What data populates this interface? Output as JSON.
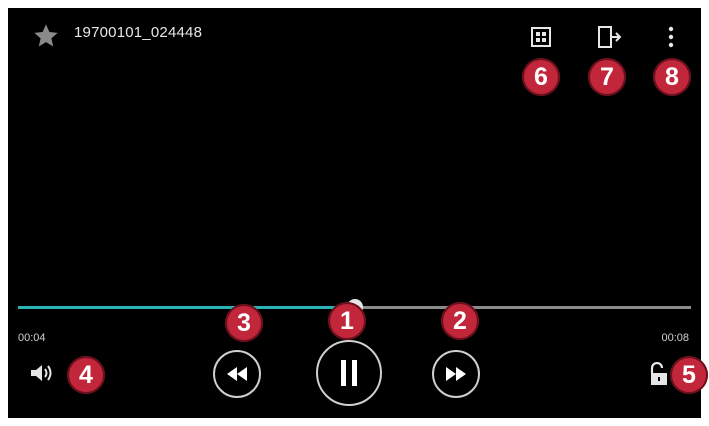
{
  "header": {
    "title": "19700101_024448"
  },
  "playback": {
    "elapsed": "00:04",
    "total": "00:08",
    "progress": 0.5
  },
  "callouts": [
    "1",
    "2",
    "3",
    "4",
    "5",
    "6",
    "7",
    "8"
  ],
  "icons": {
    "favorite": "star-icon",
    "capture": "grid-icon",
    "share": "screen-share-icon",
    "more": "more-vert-icon",
    "volume": "speaker-icon",
    "lock": "unlock-icon",
    "rewind": "rewind-icon",
    "play_pause": "pause-icon",
    "forward": "fast-forward-icon"
  },
  "colors": {
    "progress": "#2ab3b5",
    "callout": "#c1263a"
  }
}
